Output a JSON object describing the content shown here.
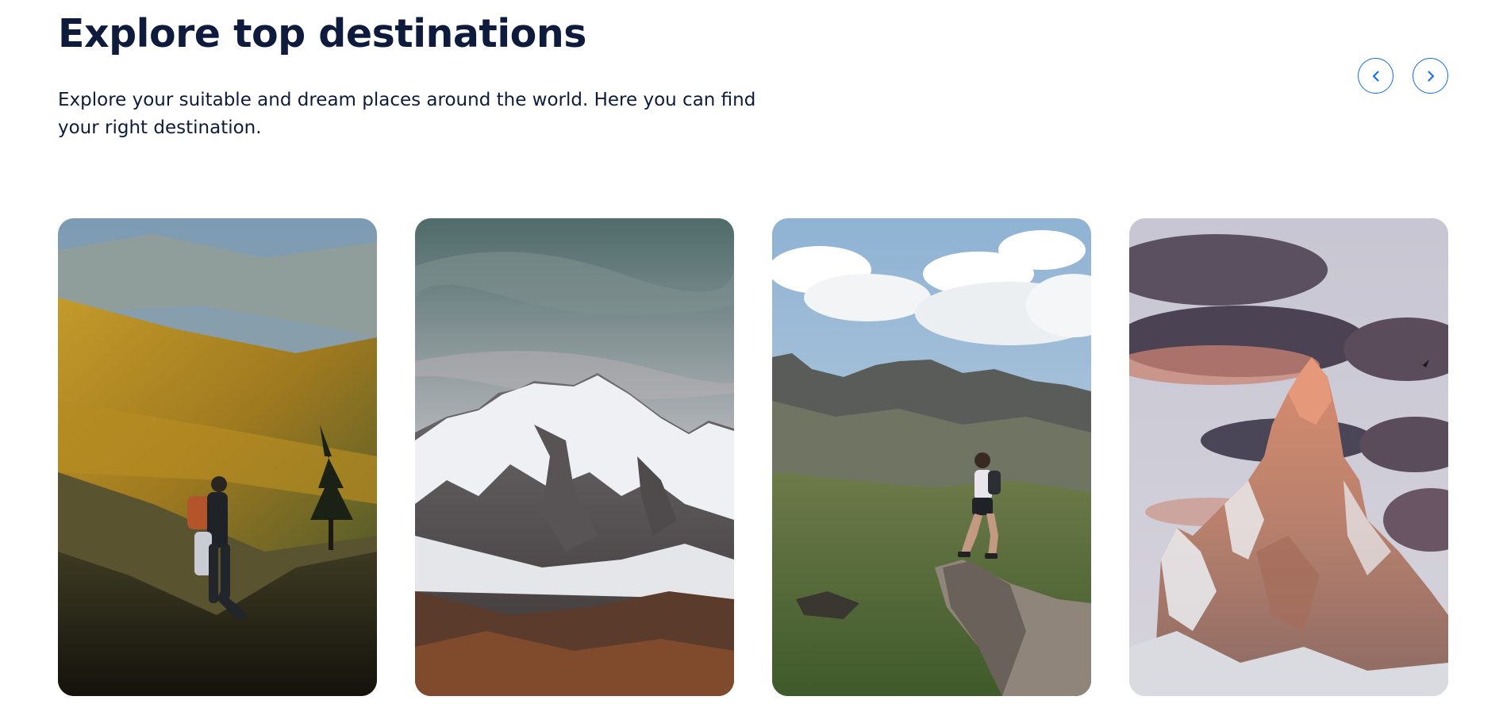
{
  "section": {
    "title": "Explore top destinations",
    "description": "Explore your suitable and dream places around the world. Here you can find your right destination."
  },
  "carousel": {
    "accent_color": "#1a73e8",
    "prev_icon": "chevron-left-icon",
    "next_icon": "chevron-right-icon"
  },
  "destinations": [
    {
      "image": "hiker-on-autumn-forest-mountainside"
    },
    {
      "image": "snow-capped-mountain-peaks"
    },
    {
      "image": "hiker-on-rocky-cliff-edge"
    },
    {
      "image": "sunset-lit-rocky-mountain-spire"
    }
  ]
}
